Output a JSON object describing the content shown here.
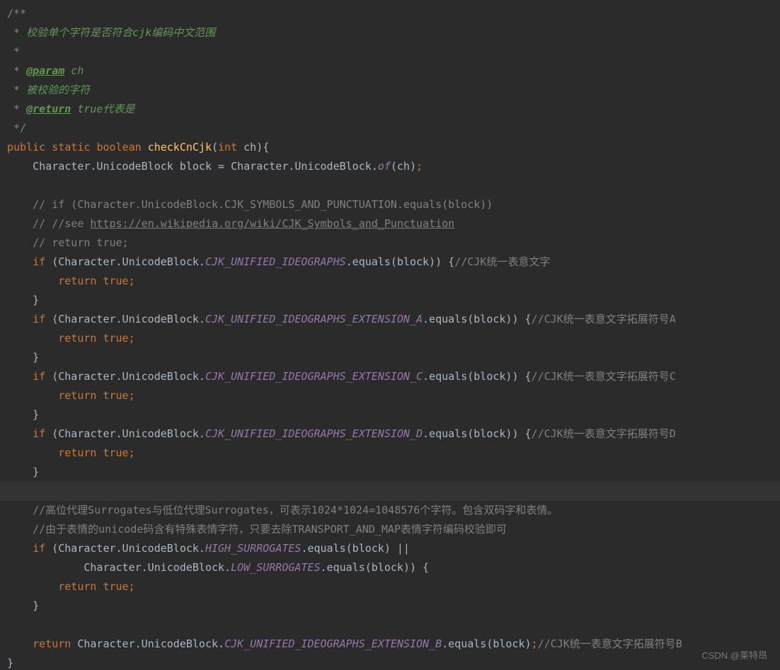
{
  "doc": {
    "open": "/**",
    "l1": " 校验单个字符是否符合cjk编码中文范围",
    "blank": "",
    "param_tag": "@param",
    "param_name": " ch",
    "l4": " 被校验的字符",
    "return_tag": "@return",
    "return_txt": " true代表是",
    "close": " */"
  },
  "sig": {
    "public": "public",
    "static": "static",
    "boolean": "boolean",
    "name": "checkCnCjk",
    "int": "int",
    "param": "ch"
  },
  "body": {
    "decl_lhs": "Character.UnicodeBlock block = Character.UnicodeBlock.",
    "of": "of",
    "decl_args": "(ch)",
    "c1": "// if (Character.UnicodeBlock.CJK_SYMBOLS_AND_PUNCTUATION.equals(block))",
    "c2a": "// //see ",
    "c2b": "https://en.wikipedia.org/wiki/CJK_Symbols_and_Punctuation",
    "c3": "// return true;",
    "if": "if",
    "chk_pre": "(Character.UnicodeBlock.",
    "chk_post": ".equals(block)) {",
    "chk_post_or": ".equals(block) ||",
    "chk_post_end": ".equals(block)) {",
    "const1": "CJK_UNIFIED_IDEOGRAPHS",
    "cmt1": "//CJK统一表意文字",
    "const2": "CJK_UNIFIED_IDEOGRAPHS_EXTENSION_A",
    "cmt2": "//CJK统一表意文字拓展符号A",
    "const3": "CJK_UNIFIED_IDEOGRAPHS_EXTENSION_C",
    "cmt3": "//CJK统一表意文字拓展符号C",
    "const4": "CJK_UNIFIED_IDEOGRAPHS_EXTENSION_D",
    "cmt4": "//CJK统一表意文字拓展符号D",
    "surro_c1": "//高位代理Surrogates与低位代理Surrogates，可表示1024*1024=1048576个字符。包含双码字和表情。",
    "surro_c2": "//由于表情的unicode码含有特殊表情字符，只要去除TRANSPORT_AND_MAP表情字符编码校验即可",
    "const5": "HIGH_SURROGATES",
    "low_pre": "Character.UnicodeBlock.",
    "const6": "LOW_SURROGATES",
    "return": "return",
    "true": "true",
    "ret_pre": "Character.UnicodeBlock.",
    "const7": "CJK_UNIFIED_IDEOGRAPHS_EXTENSION_B",
    "ret_post": ".equals(block)",
    "cmt7": "//CJK统一表意文字拓展符号B",
    "close": "}"
  },
  "watermark": "CSDN @莱特昂"
}
